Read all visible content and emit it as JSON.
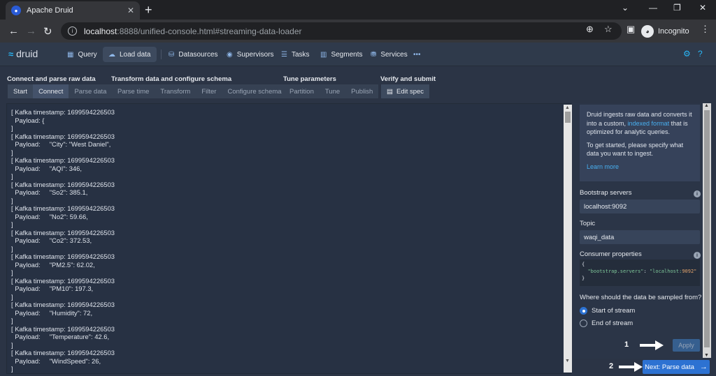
{
  "browser": {
    "tab_title": "Apache Druid",
    "url_host": "localhost",
    "url_rest": ":8888/unified-console.html#streaming-data-loader",
    "profile_label": "Incognito"
  },
  "header": {
    "logo_text": "druid",
    "nav": [
      {
        "label": "Query"
      },
      {
        "label": "Load data"
      },
      {
        "label": "Datasources"
      },
      {
        "label": "Supervisors"
      },
      {
        "label": "Tasks"
      },
      {
        "label": "Segments"
      },
      {
        "label": "Services"
      }
    ],
    "more": "•••"
  },
  "steps": {
    "groups": [
      {
        "title": "Connect and parse raw data"
      },
      {
        "title": "Transform data and configure schema"
      },
      {
        "title": "Tune parameters"
      },
      {
        "title": "Verify and submit"
      }
    ],
    "items": [
      {
        "label": "Start"
      },
      {
        "label": "Connect"
      },
      {
        "label": "Parse data"
      },
      {
        "label": "Parse time"
      },
      {
        "label": "Transform"
      },
      {
        "label": "Filter"
      },
      {
        "label": "Configure schema"
      },
      {
        "label": "Partition"
      },
      {
        "label": "Tune"
      },
      {
        "label": "Publish"
      },
      {
        "label": "Edit spec"
      }
    ]
  },
  "sample": {
    "text": "[ Kafka timestamp: 1699594226503\n  Payload: {\n]\n[ Kafka timestamp: 1699594226503\n  Payload:     \"City\": \"West Daniel\",\n]\n[ Kafka timestamp: 1699594226503\n  Payload:     \"AQI\": 346,\n]\n[ Kafka timestamp: 1699594226503\n  Payload:     \"So2\": 385.1,\n]\n[ Kafka timestamp: 1699594226503\n  Payload:     \"No2\": 59.66,\n]\n[ Kafka timestamp: 1699594226503\n  Payload:     \"Co2\": 372.53,\n]\n[ Kafka timestamp: 1699594226503\n  Payload:     \"PM2.5\": 62.02,\n]\n[ Kafka timestamp: 1699594226503\n  Payload:     \"PM10\": 197.3,\n]\n[ Kafka timestamp: 1699594226503\n  Payload:     \"Humidity\": 72,\n]\n[ Kafka timestamp: 1699594226503\n  Payload:     \"Temperature\": 42.6,\n]\n[ Kafka timestamp: 1699594226503\n  Payload:     \"WindSpeed\": 26,\n]"
  },
  "panel": {
    "info_p1_a": "Druid ingests raw data and converts it into a custom, ",
    "info_p1_link": "indexed format",
    "info_p1_b": " that is optimized for analytic queries.",
    "info_p2": "To get started, please specify what data you want to ingest.",
    "learn_more": "Learn more",
    "bootstrap_label": "Bootstrap servers",
    "bootstrap_value": "localhost:9092",
    "topic_label": "Topic",
    "topic_value": "waqi_data",
    "consumer_label": "Consumer properties",
    "consumer_open": "{",
    "consumer_key": "\"bootstrap.servers\"",
    "consumer_colon": ": ",
    "consumer_val_a": "\"localhost:",
    "consumer_val_b": "9092\"",
    "consumer_close": "}",
    "sample_question": "Where should the data be sampled from?",
    "opt_start": "Start of stream",
    "opt_end": "End of stream",
    "apply": "Apply",
    "next": "Next: Parse data"
  },
  "annotations": {
    "one": "1",
    "two": "2"
  }
}
